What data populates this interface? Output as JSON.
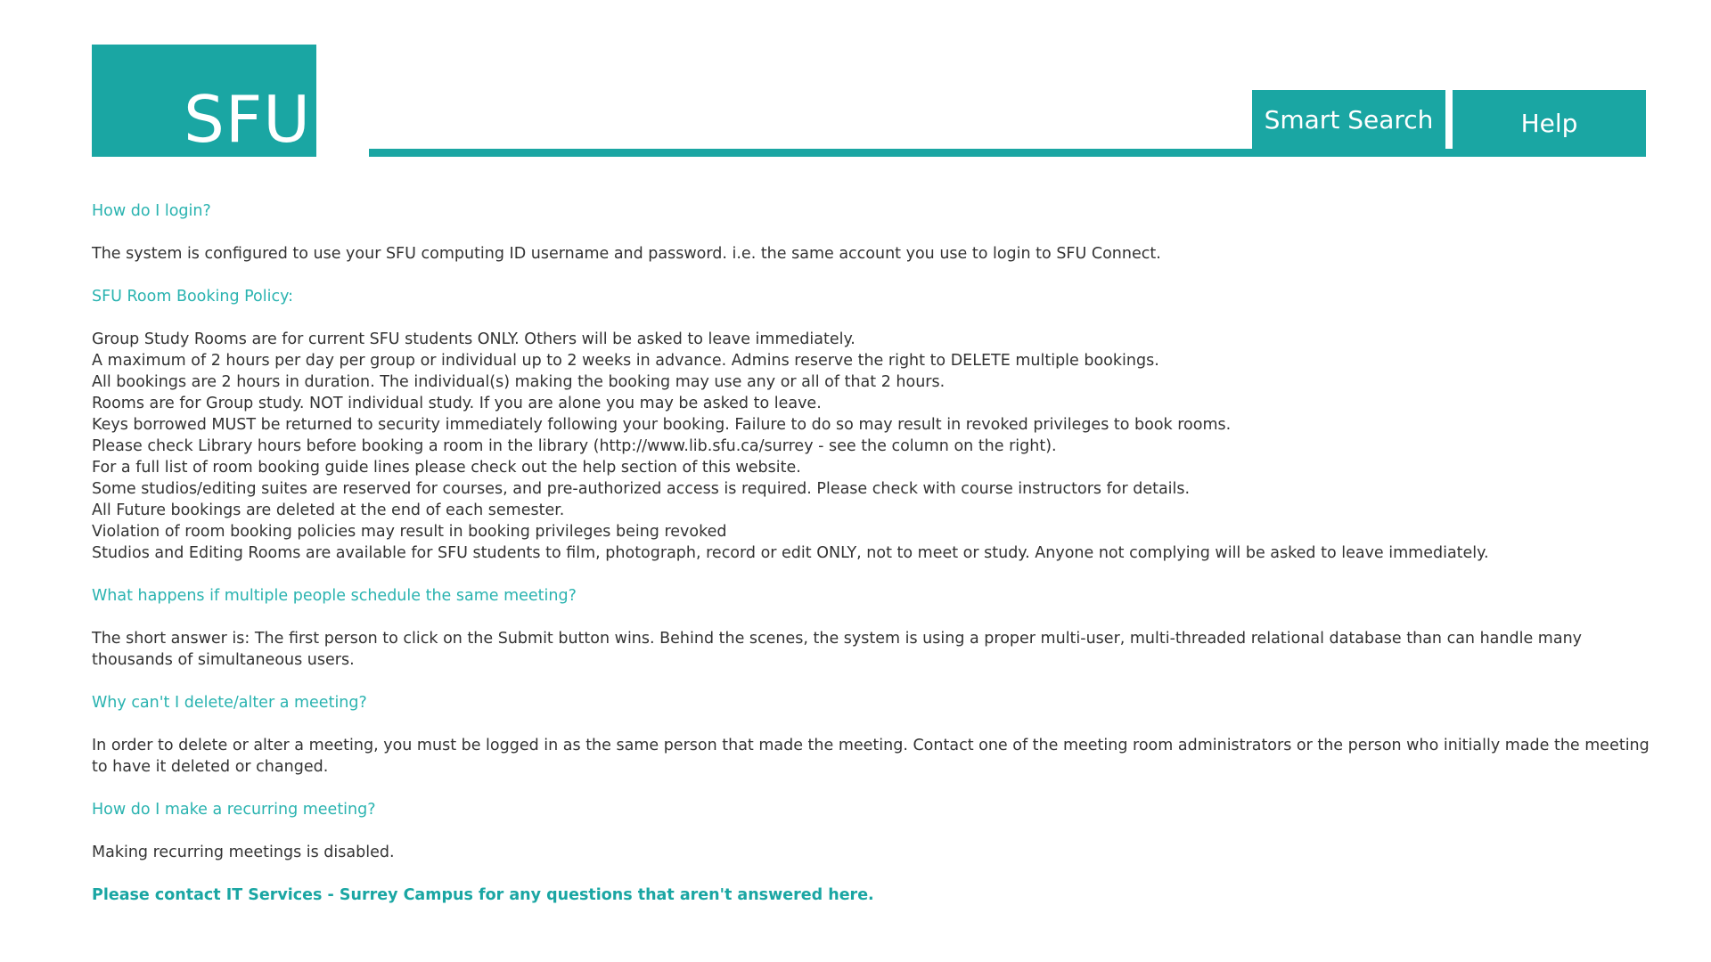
{
  "header": {
    "logo_text": "SFU",
    "nav": {
      "smart_search": "Smart Search",
      "help": "Help"
    }
  },
  "faq": {
    "login": {
      "question": "How do I login?",
      "answer": "The system is configured to use your SFU computing ID username and password. i.e. the same account you use to login to SFU Connect."
    },
    "policy": {
      "heading": "SFU Room Booking Policy:",
      "items": [
        "Group Study Rooms are for current SFU students ONLY. Others will be asked to leave immediately.",
        "A maximum of 2 hours per day per group or individual up to 2 weeks in advance. Admins reserve the right to DELETE multiple bookings.",
        "All bookings are 2 hours in duration. The individual(s) making the booking may use any or all of that 2 hours.",
        "Rooms are for Group study. NOT individual study. If you are alone you may be asked to leave.",
        "Keys borrowed MUST be returned to security immediately following your booking. Failure to do so may result in revoked privileges to book rooms.",
        "Please check Library hours before booking a room in the library (http://www.lib.sfu.ca/surrey - see the column on the right).",
        "For a full list of room booking guide lines please check out the help section of this website.",
        "Some studios/editing suites are reserved for courses, and pre-authorized access is required. Please check with course instructors for details.",
        "All Future bookings are deleted at the end of each semester.",
        "Violation of room booking policies may result in booking privileges being revoked",
        "Studios and Editing Rooms are available for SFU students to film, photograph, record or edit ONLY, not to meet or study. Anyone not complying will be asked to leave immediately."
      ]
    },
    "multiple": {
      "question": "What happens if multiple people schedule the same meeting?",
      "answer": "The short answer is: The first person to click on the Submit button wins. Behind the scenes, the system is using a proper multi-user, multi-threaded relational database than can handle many thousands of simultaneous users."
    },
    "delete": {
      "question": "Why can't I delete/alter a meeting?",
      "answer": "In order to delete or alter a meeting, you must be logged in as the same person that made the meeting. Contact one of the meeting room administrators or the person who initially made the meeting to have it deleted or changed."
    },
    "recurring": {
      "question": "How do I make a recurring meeting?",
      "answer": "Making recurring meetings is disabled."
    },
    "contact": "Please contact IT Services - Surrey Campus for any questions that aren't answered here."
  },
  "colors": {
    "brand": "#1aa6a3",
    "question": "#2ab3b0",
    "body_text": "#333333"
  }
}
